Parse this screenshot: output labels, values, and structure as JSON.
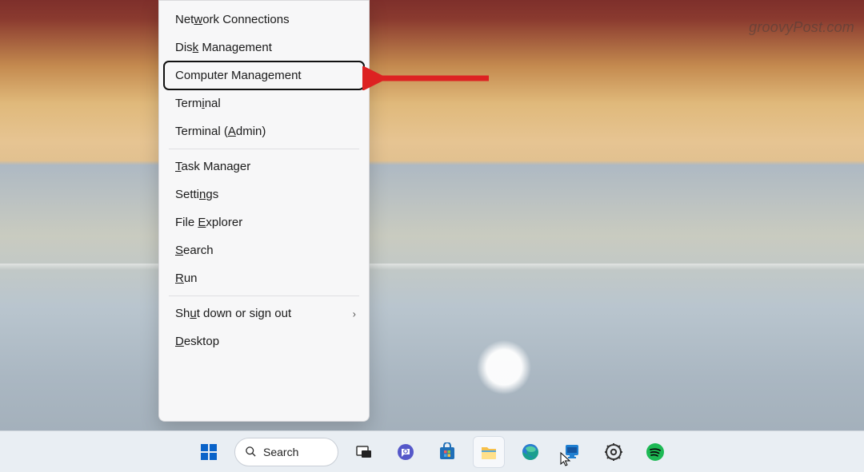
{
  "watermark": "groovyPost.com",
  "menu": {
    "items": [
      {
        "pre": "Net",
        "u": "w",
        "post": "ork Connections"
      },
      {
        "pre": "Dis",
        "u": "k",
        "post": " Management"
      },
      {
        "pre": "Computer Mana",
        "u": "g",
        "post": "ement",
        "highlight": true
      },
      {
        "pre": "Term",
        "u": "i",
        "post": "nal"
      },
      {
        "pre": "Terminal (",
        "u": "A",
        "post": "dmin)"
      }
    ],
    "items2": [
      {
        "pre": "",
        "u": "T",
        "post": "ask Manager"
      },
      {
        "pre": "Setti",
        "u": "n",
        "post": "gs"
      },
      {
        "pre": "File ",
        "u": "E",
        "post": "xplorer"
      },
      {
        "pre": "",
        "u": "S",
        "post": "earch"
      },
      {
        "pre": "",
        "u": "R",
        "post": "un"
      }
    ],
    "items3": [
      {
        "pre": "Sh",
        "u": "u",
        "post": "t down or sign out",
        "submenu": true
      },
      {
        "pre": "",
        "u": "D",
        "post": "esktop"
      }
    ]
  },
  "search": {
    "label": "Search"
  },
  "taskbar_icons": [
    "start",
    "search",
    "taskview",
    "chat",
    "store",
    "explorer",
    "edge",
    "copilot",
    "settings",
    "spotify"
  ]
}
